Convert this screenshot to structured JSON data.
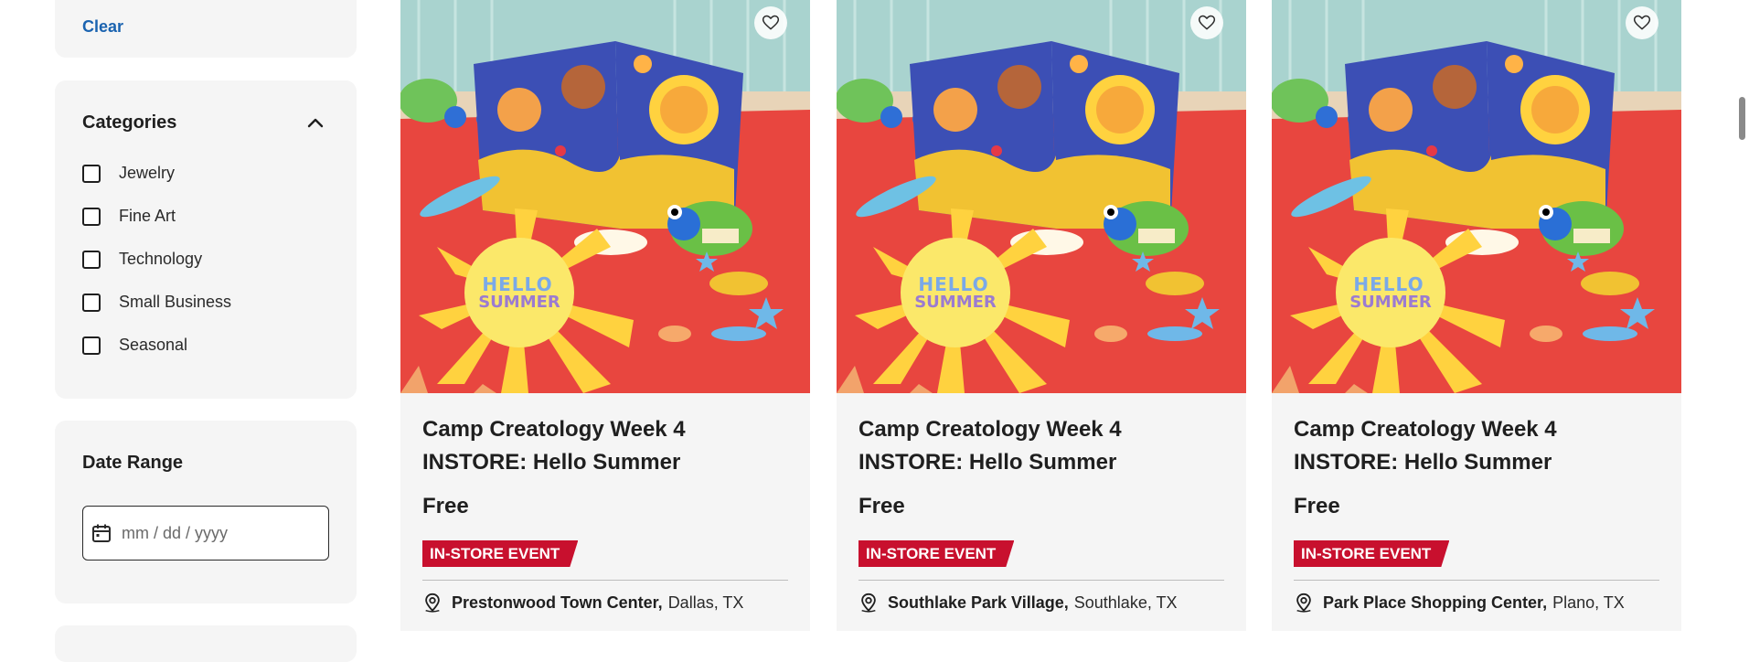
{
  "filters": {
    "clear_label": "Clear",
    "categories": {
      "title": "Categories",
      "items": [
        {
          "label": "Jewelry",
          "checked": false
        },
        {
          "label": "Fine Art",
          "checked": false
        },
        {
          "label": "Technology",
          "checked": false
        },
        {
          "label": "Small Business",
          "checked": false
        },
        {
          "label": "Seasonal",
          "checked": false
        }
      ]
    },
    "date_range": {
      "title": "Date Range",
      "placeholder": "mm / dd / yyyy",
      "value": ""
    }
  },
  "cards": [
    {
      "title": "Camp Creatology Week 4 INSTORE: Hello Summer",
      "price": "Free",
      "badge": "IN-STORE EVENT",
      "location_name": "Prestonwood Town Center,",
      "location_city": "Dallas, TX",
      "image_text": "HELLO SUMMER",
      "icon": "heart-icon"
    },
    {
      "title": "Camp Creatology Week 4 INSTORE: Hello Summer",
      "price": "Free",
      "badge": "IN-STORE EVENT",
      "location_name": "Southlake Park Village,",
      "location_city": "Southlake, TX",
      "image_text": "HELLO SUMMER",
      "icon": "heart-icon"
    },
    {
      "title": "Camp Creatology Week 4 INSTORE: Hello Summer",
      "price": "Free",
      "badge": "IN-STORE EVENT",
      "location_name": "Park Place Shopping Center,",
      "location_city": "Plano, TX",
      "image_text": "HELLO SUMMER",
      "icon": "heart-icon"
    }
  ],
  "colors": {
    "accent_link": "#1a63b0",
    "badge_red": "#c8102e",
    "panel_bg": "#f5f5f5"
  }
}
